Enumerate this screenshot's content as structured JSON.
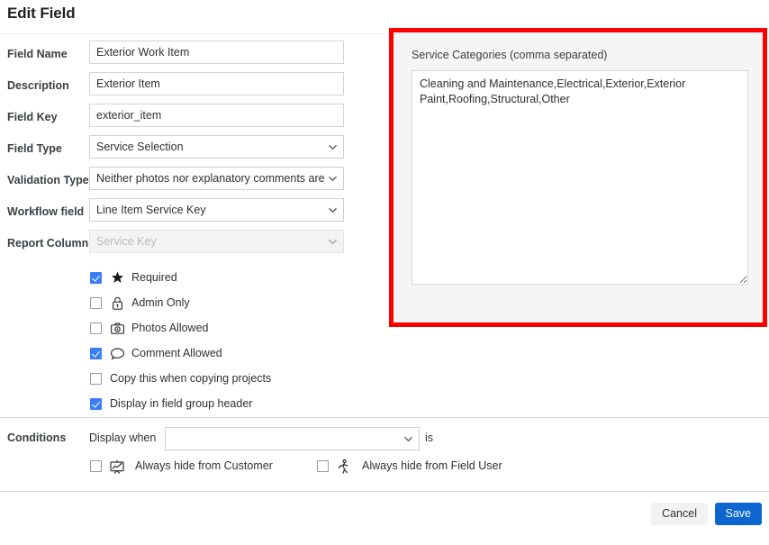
{
  "header": {
    "title": "Edit Field"
  },
  "form": {
    "fields": [
      {
        "label": "Field Name",
        "type": "text",
        "value": "Exterior Work Item"
      },
      {
        "label": "Description",
        "type": "text",
        "value": "Exterior Item"
      },
      {
        "label": "Field Key",
        "type": "text",
        "value": "exterior_item"
      },
      {
        "label": "Field Type",
        "type": "select",
        "value": "Service Selection",
        "icon": "chevron-down-icon"
      },
      {
        "label": "Validation Type",
        "type": "select",
        "value": "Neither photos nor explanatory comments are re",
        "icon": "chevron-down-icon"
      },
      {
        "label": "Workflow field",
        "type": "select",
        "value": "Line Item Service Key",
        "icon": "chevron-down-icon"
      },
      {
        "label": "Report Column",
        "type": "select",
        "value": "Service Key",
        "icon": "chevron-down-icon",
        "disabled": true
      }
    ]
  },
  "checkboxes": [
    {
      "label": "Required",
      "checked": true,
      "icon": "star-icon"
    },
    {
      "label": "Admin Only",
      "checked": false,
      "icon": "lock-icon"
    },
    {
      "label": "Photos Allowed",
      "checked": false,
      "icon": "camera-icon"
    },
    {
      "label": "Comment Allowed",
      "checked": true,
      "icon": "comment-bubble-icon"
    },
    {
      "label": "Copy this when copying projects",
      "checked": false,
      "icon": null
    },
    {
      "label": "Display in field group header",
      "checked": true,
      "icon": null
    }
  ],
  "conditions": {
    "section_label": "Conditions",
    "display_when_label": "Display when",
    "display_when_value": "",
    "is_label": "is",
    "toggles": [
      {
        "label": "Always hide from Customer",
        "checked": false,
        "icon": "presentation-chart-icon"
      },
      {
        "label": "Always hide from Field User",
        "checked": false,
        "icon": "field-worker-icon"
      }
    ]
  },
  "service_panel": {
    "label": "Service Categories (comma separated)",
    "value": "Cleaning and Maintenance,Electrical,Exterior,Exterior Paint,Roofing,Structural,Other",
    "highlight_color": "#fc0000"
  },
  "footer": {
    "cancel_label": "Cancel",
    "save_label": "Save",
    "save_color": "#0b66d0"
  }
}
